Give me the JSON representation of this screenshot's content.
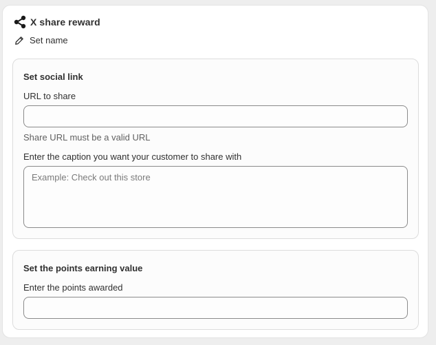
{
  "header": {
    "title": "X share reward",
    "set_name_label": "Set name"
  },
  "social_section": {
    "heading": "Set social link",
    "url_label": "URL to share",
    "url_value": "",
    "url_help": "Share URL must be a valid URL",
    "caption_label": "Enter the caption you want your customer to share with",
    "caption_placeholder": "Example: Check out this store",
    "caption_value": ""
  },
  "points_section": {
    "heading": "Set the points earning value",
    "points_label": "Enter the points awarded",
    "points_value": ""
  },
  "icons": {
    "header_icon": "share-icon",
    "set_name_icon": "pencil-icon"
  }
}
